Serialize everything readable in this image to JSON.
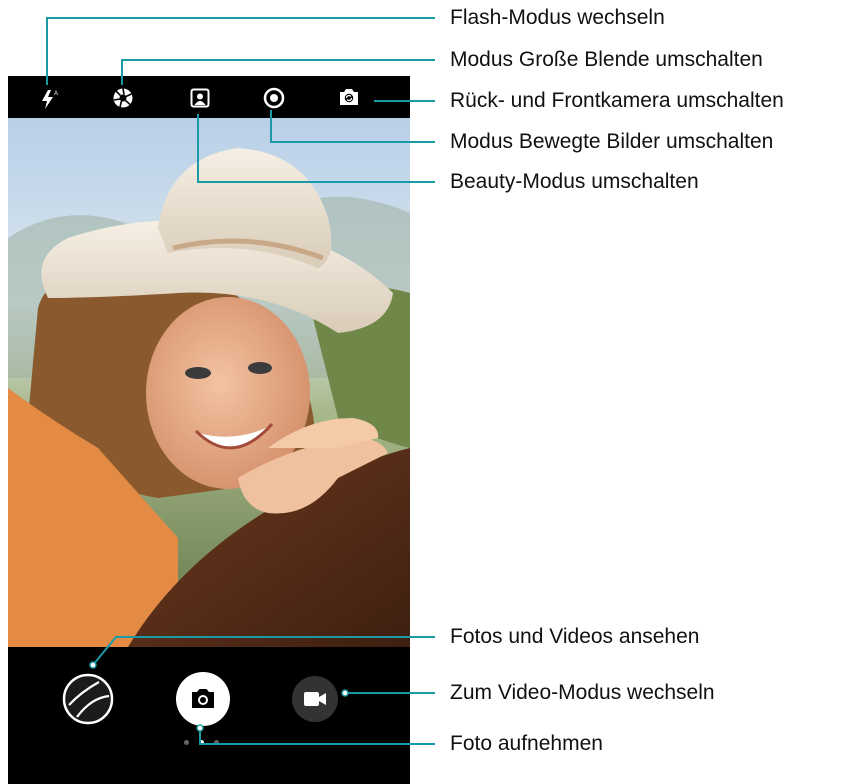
{
  "app": {
    "top_bar": {
      "icons": [
        "flash-auto-icon",
        "aperture-icon",
        "beauty-icon",
        "moving-picture-icon",
        "switch-camera-icon"
      ]
    },
    "bottom_bar": {
      "icons": [
        "gallery-icon",
        "shutter-camera-icon",
        "video-camera-icon"
      ],
      "page_indicator": {
        "count": 3,
        "active_index": 1
      }
    }
  },
  "callouts": {
    "flash": "Flash-Modus wechseln",
    "aperture": "Modus Große Blende umschalten",
    "switch_camera": "Rück- und Frontkamera umschalten",
    "moving_picture": "Modus Bewegte Bilder umschalten",
    "beauty": "Beauty-Modus umschalten",
    "gallery": "Fotos und Videos ansehen",
    "video_mode": "Zum Video-Modus wechseln",
    "take_photo": "Foto aufnehmen"
  },
  "colors": {
    "leader_line": "#1a9aa6",
    "ui_black": "#000000",
    "icon_white": "#ffffff"
  }
}
